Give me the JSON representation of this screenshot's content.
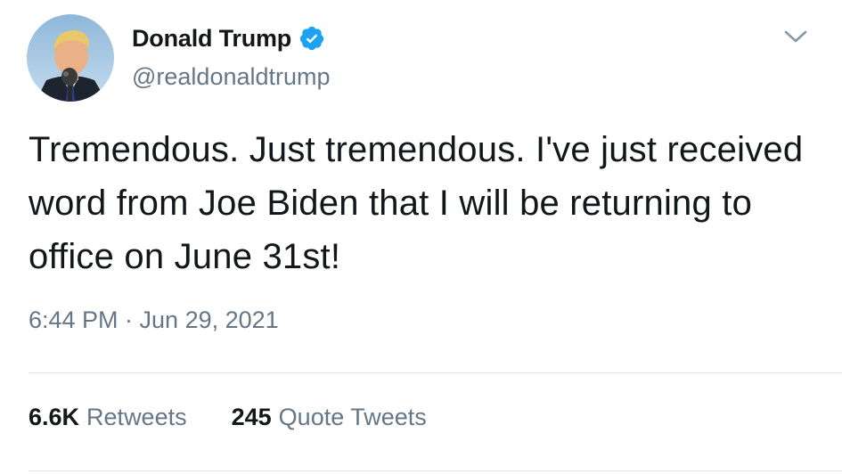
{
  "tweet": {
    "author": {
      "display_name": "Donald Trump",
      "handle": "@realdonaldtrump",
      "verified_icon": "verified-badge-icon",
      "avatar_icon": "profile-avatar"
    },
    "text": "Tremendous. Just tremendous. I've just received word from Joe Biden that I will be returning to office on June 31st!",
    "timestamp": "6:44 PM · Jun 29, 2021",
    "stats": {
      "retweets": {
        "count": "6.6K",
        "label": "Retweets"
      },
      "quote_tweets": {
        "count": "245",
        "label": "Quote Tweets"
      }
    },
    "menu_icon": "chevron-down-icon"
  },
  "colors": {
    "text_primary": "#14171a",
    "text_secondary": "#657786",
    "verified_blue": "#1da1f2",
    "divider": "#e1e8ed"
  }
}
